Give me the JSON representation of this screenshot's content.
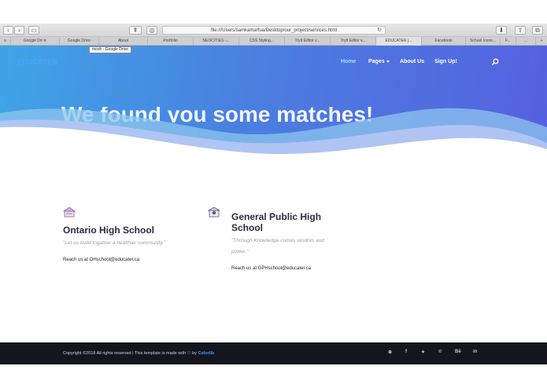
{
  "browser": {
    "url": "file:///Users/samkamarfua/Desktop/our_project/services.html",
    "tabs": [
      {
        "label": "s"
      },
      {
        "label": "Google Dri ✕"
      },
      {
        "label": "Google Drive"
      },
      {
        "label": "About"
      },
      {
        "label": "Portfolio"
      },
      {
        "label": "NEOCITIES -..."
      },
      {
        "label": "CSS Styling..."
      },
      {
        "label": "TryIt Editor v..."
      },
      {
        "label": "TryIt Editor v..."
      },
      {
        "label": "EDUCATER |..."
      },
      {
        "label": "Facebook"
      },
      {
        "label": "School Icons..."
      },
      {
        "label": "F..."
      },
      {
        "label": "..."
      },
      {
        "label": "+"
      }
    ],
    "tooltip": "mosh - Google Drive"
  },
  "nav": {
    "brand": "EDUCATER",
    "items": [
      "Home",
      "Pages",
      "About Us",
      "Sign Up!"
    ]
  },
  "hero": {
    "title": "We found you some matches!"
  },
  "schools": [
    {
      "name": "Ontario High School",
      "motto": "\"Let us build togather a healthier community.\"",
      "contact": "Reach us at OHschool@educater.ca"
    },
    {
      "name": "General Public High School",
      "motto": "\"Through Knowledge comes wisdom and power.\"",
      "contact": "Reach us at GPHschool@educater.ca"
    }
  ],
  "footer": {
    "copyright_prefix": "Copyright ©2018 All rights reserved | This template is made with",
    "by": "by",
    "brand": "Colorlib",
    "social": [
      "dribbble-icon",
      "f",
      "twitter-icon",
      "pinterest-icon",
      "Bē",
      "in"
    ]
  },
  "colors": {
    "brand": "#4da3ff",
    "footer_bg": "#15151f",
    "hero_start": "#3fa5e6",
    "hero_end": "#5660e0"
  }
}
